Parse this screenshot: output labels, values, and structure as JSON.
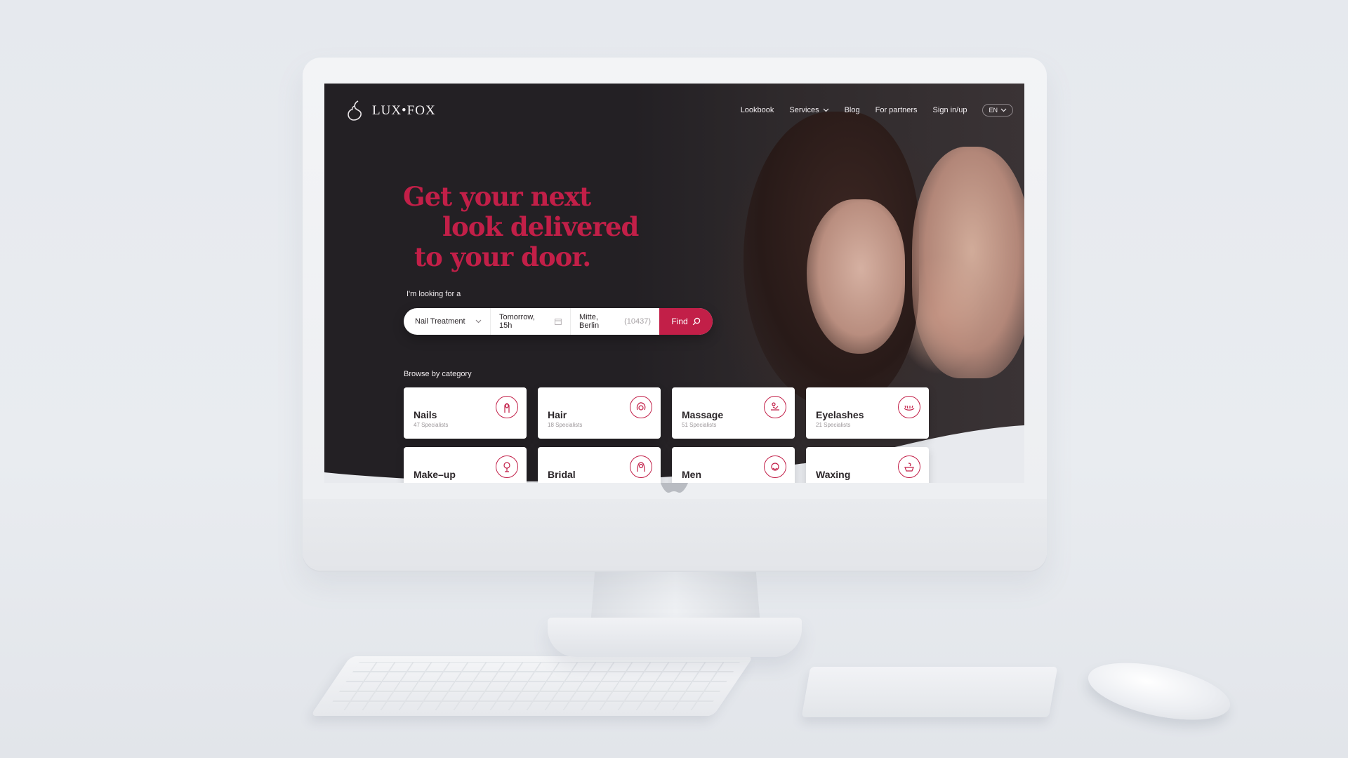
{
  "brand": {
    "name": "LUX•FOX",
    "accent_color": "#c21f48",
    "logo_icon": "fox-swirl-icon"
  },
  "nav": {
    "links": [
      {
        "label": "Lookbook"
      },
      {
        "label": "Services",
        "has_dropdown": true
      },
      {
        "label": "Blog"
      },
      {
        "label": "For partners"
      },
      {
        "label": "Sign in/up"
      }
    ],
    "language": "EN"
  },
  "hero": {
    "headline": [
      "Get your next",
      "look delivered",
      "to your door."
    ],
    "looking_label": "I'm looking for a"
  },
  "search": {
    "treatment": "Nail Treatment",
    "date": "Tomorrow, 15h",
    "location": "Mitte, Berlin",
    "zip": "(10437)",
    "find_label": "Find"
  },
  "categories": {
    "label": "Browse by category",
    "items": [
      {
        "title": "Nails",
        "sub": "47 Specialists",
        "icon": "nail-icon"
      },
      {
        "title": "Hair",
        "sub": "18 Specialists",
        "icon": "hair-icon"
      },
      {
        "title": "Massage",
        "sub": "51 Specialists",
        "icon": "massage-icon"
      },
      {
        "title": "Eyelashes",
        "sub": "21 Specialists",
        "icon": "eyelash-icon"
      },
      {
        "title": "Make–up",
        "sub": "",
        "icon": "makeup-icon"
      },
      {
        "title": "Bridal",
        "sub": "",
        "icon": "bride-icon"
      },
      {
        "title": "Men",
        "sub": "",
        "icon": "men-icon"
      },
      {
        "title": "Waxing",
        "sub": "",
        "icon": "wax-icon"
      }
    ]
  }
}
